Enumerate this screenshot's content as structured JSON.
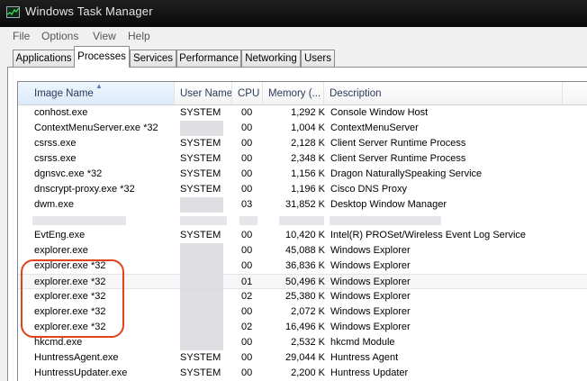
{
  "window": {
    "title": "Windows Task Manager"
  },
  "menu": [
    "File",
    "Options",
    "View",
    "Help"
  ],
  "tabs": [
    "Applications",
    "Processes",
    "Services",
    "Performance",
    "Networking",
    "Users"
  ],
  "active_tab": "Processes",
  "columns": [
    "Image Name",
    "User Name",
    "CPU",
    "Memory (...",
    "Description"
  ],
  "processes": [
    {
      "name": "conhost.exe",
      "user": "SYSTEM",
      "cpu": "00",
      "mem": "1,292 K",
      "desc": "Console Window Host"
    },
    {
      "name": "ContextMenuServer.exe *32",
      "user": "",
      "cpu": "00",
      "mem": "1,004 K",
      "desc": "ContextMenuServer"
    },
    {
      "name": "csrss.exe",
      "user": "SYSTEM",
      "cpu": "00",
      "mem": "2,128 K",
      "desc": "Client Server Runtime Process"
    },
    {
      "name": "csrss.exe",
      "user": "SYSTEM",
      "cpu": "00",
      "mem": "2,348 K",
      "desc": "Client Server Runtime Process"
    },
    {
      "name": "dgnsvc.exe *32",
      "user": "SYSTEM",
      "cpu": "00",
      "mem": "1,156 K",
      "desc": "Dragon NaturallySpeaking Service"
    },
    {
      "name": "dnscrypt-proxy.exe *32",
      "user": "SYSTEM",
      "cpu": "00",
      "mem": "1,196 K",
      "desc": "Cisco DNS Proxy"
    },
    {
      "name": "dwm.exe",
      "user": "",
      "cpu": "03",
      "mem": "31,852 K",
      "desc": "Desktop Window Manager"
    },
    {
      "name": "",
      "user": "",
      "cpu": "",
      "mem": "",
      "desc": ""
    },
    {
      "name": "EvtEng.exe",
      "user": "SYSTEM",
      "cpu": "00",
      "mem": "10,420 K",
      "desc": "Intel(R) PROSet/Wireless Event Log Service"
    },
    {
      "name": "explorer.exe",
      "user": "",
      "cpu": "00",
      "mem": "45,088 K",
      "desc": "Windows Explorer"
    },
    {
      "name": "explorer.exe *32",
      "user": "",
      "cpu": "00",
      "mem": "36,836 K",
      "desc": "Windows Explorer"
    },
    {
      "name": "explorer.exe *32",
      "user": "",
      "cpu": "01",
      "mem": "50,496 K",
      "desc": "Windows Explorer"
    },
    {
      "name": "explorer.exe *32",
      "user": "",
      "cpu": "02",
      "mem": "25,380 K",
      "desc": "Windows Explorer"
    },
    {
      "name": "explorer.exe *32",
      "user": "",
      "cpu": "00",
      "mem": "2,072 K",
      "desc": "Windows Explorer"
    },
    {
      "name": "explorer.exe *32",
      "user": "",
      "cpu": "02",
      "mem": "16,496 K",
      "desc": "Windows Explorer"
    },
    {
      "name": "hkcmd.exe",
      "user": "",
      "cpu": "00",
      "mem": "2,532 K",
      "desc": "hkcmd Module"
    },
    {
      "name": "HuntressAgent.exe",
      "user": "SYSTEM",
      "cpu": "00",
      "mem": "29,044 K",
      "desc": "Huntress Agent"
    },
    {
      "name": "HuntressUpdater.exe",
      "user": "SYSTEM",
      "cpu": "00",
      "mem": "2,200 K",
      "desc": "Huntress Updater"
    }
  ],
  "colors": {
    "highlight_ring": "#e2421a",
    "titlebar": "#111111"
  }
}
